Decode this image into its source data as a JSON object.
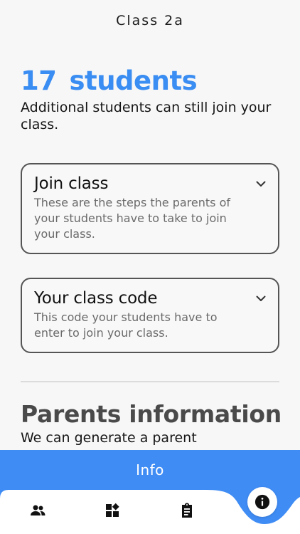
{
  "header": {
    "title": "Class 2a"
  },
  "summary": {
    "count": "17",
    "count_word": "students",
    "subtitle": "Additional students can still join your class."
  },
  "cards": [
    {
      "title": "Join class",
      "description": "These are the steps the parents of your students have to take to join your class."
    },
    {
      "title": "Your class code",
      "description": "This code your students have to enter to join your class."
    }
  ],
  "parents": {
    "title": "Parents information",
    "subtitle": "We can generate a parent"
  },
  "info_bar": {
    "label": "Info"
  },
  "bottom_nav": {
    "items": [
      {
        "icon": "people-icon"
      },
      {
        "icon": "widgets-icon"
      },
      {
        "icon": "clipboard-icon"
      },
      {
        "icon": "info-icon",
        "active": true
      }
    ]
  },
  "colors": {
    "accent": "#3a8df2",
    "info_bar": "#3f8cf5",
    "card_border": "#555555"
  }
}
